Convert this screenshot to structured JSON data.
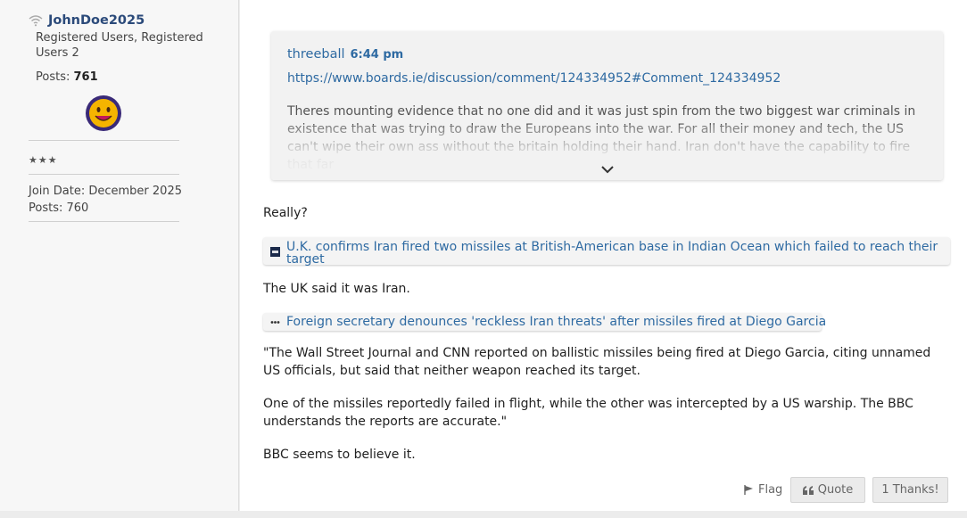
{
  "user": {
    "username": "JohnDoe2025",
    "role": "Registered Users, Registered Users 2",
    "posts_label": "Posts: ",
    "posts_count": "761",
    "stars": "★★★",
    "join_date": "Join Date: December 2025",
    "posts_line": "Posts: 760"
  },
  "quote": {
    "author": "threeball",
    "time": "6:44 pm",
    "link": "https://www.boards.ie/discussion/comment/124334952#Comment_124334952",
    "text": "Theres mounting evidence that no one did and it was just spin from the two biggest war criminals in existence that was trying to draw the Europeans into the war. For all their money and tech, the US can't wipe their own ass without the britain holding their hand. Iran don't have the capability to fire that far"
  },
  "post": {
    "p1": "Really?",
    "embed1": "U.K. confirms Iran fired two missiles at British-American base in Indian Ocean which failed to reach their target",
    "p2": "The UK said it was Iran.",
    "embed2": "Foreign secretary denounces 'reckless Iran threats' after missiles fired at Diego Garcia",
    "p3": "\"The Wall Street Journal and CNN reported on ballistic missiles being fired at Diego Garcia, citing unnamed US officials, but said that neither weapon reached its target.",
    "p4": "One of the missiles reportedly failed in flight, while the other was intercepted by a US warship. The BBC understands the reports are accurate.\"",
    "p5": "BBC seems to believe it."
  },
  "actions": {
    "flag": "Flag",
    "quote": "Quote",
    "thanks": "1 Thanks!"
  },
  "icons": {
    "status": "wifi-icon",
    "avatar": "smiley-avatar-icon",
    "expand": "chevron-down-icon",
    "flag": "flag-icon",
    "quote": "quote-marks-icon",
    "embed1": "cnbc-favicon-icon",
    "embed2": "ellipsis-favicon-icon"
  },
  "colors": {
    "link": "#2e6aa2",
    "username": "#2b4a7a",
    "avatar_bg": "#3a2a78",
    "avatar_face": "#f5b400"
  }
}
